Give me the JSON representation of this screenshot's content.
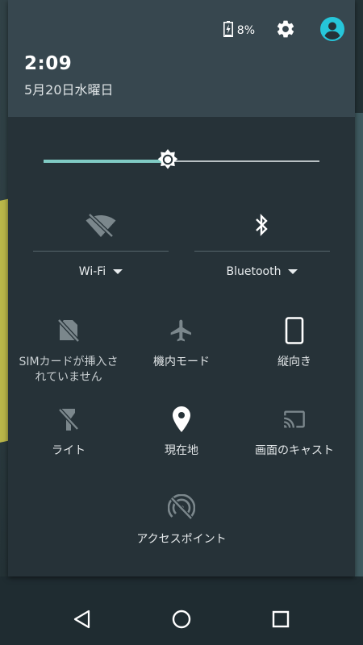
{
  "status": {
    "battery_percent": "8%",
    "battery_level": 0.08,
    "battery_charging": true
  },
  "header": {
    "time": "2:09",
    "date": "5月20日水曜日"
  },
  "brightness": {
    "level": 0.45
  },
  "connectivity": {
    "wifi": {
      "label": "Wi-Fi",
      "icon": "wifi-off-icon",
      "enabled": false
    },
    "bluetooth": {
      "label": "Bluetooth",
      "icon": "bluetooth-icon",
      "enabled": true
    }
  },
  "tiles": {
    "sim": {
      "label": "SIMカードが挿入さ\nれていません",
      "icon": "no-sim-icon",
      "enabled": false
    },
    "airplane": {
      "label": "機内モード",
      "icon": "airplane-icon",
      "enabled": false
    },
    "rotation": {
      "label": "縦向き",
      "icon": "portrait-phone-icon",
      "enabled": true
    },
    "flashlight": {
      "label": "ライト",
      "icon": "flashlight-off-icon",
      "enabled": false
    },
    "location": {
      "label": "現在地",
      "icon": "location-pin-icon",
      "enabled": true
    },
    "cast": {
      "label": "画面のキャスト",
      "icon": "cast-icon",
      "enabled": false
    },
    "hotspot": {
      "label": "アクセスポイント",
      "icon": "hotspot-off-icon",
      "enabled": false
    }
  },
  "navbar": {
    "back": "back-icon",
    "home": "home-icon",
    "recents": "recents-icon"
  },
  "colors": {
    "panel": "#263238",
    "header": "#37474f",
    "accent": "#80cbc4",
    "account": "#26c6da",
    "icon_on": "#ffffff",
    "icon_off": "#7b878c"
  }
}
